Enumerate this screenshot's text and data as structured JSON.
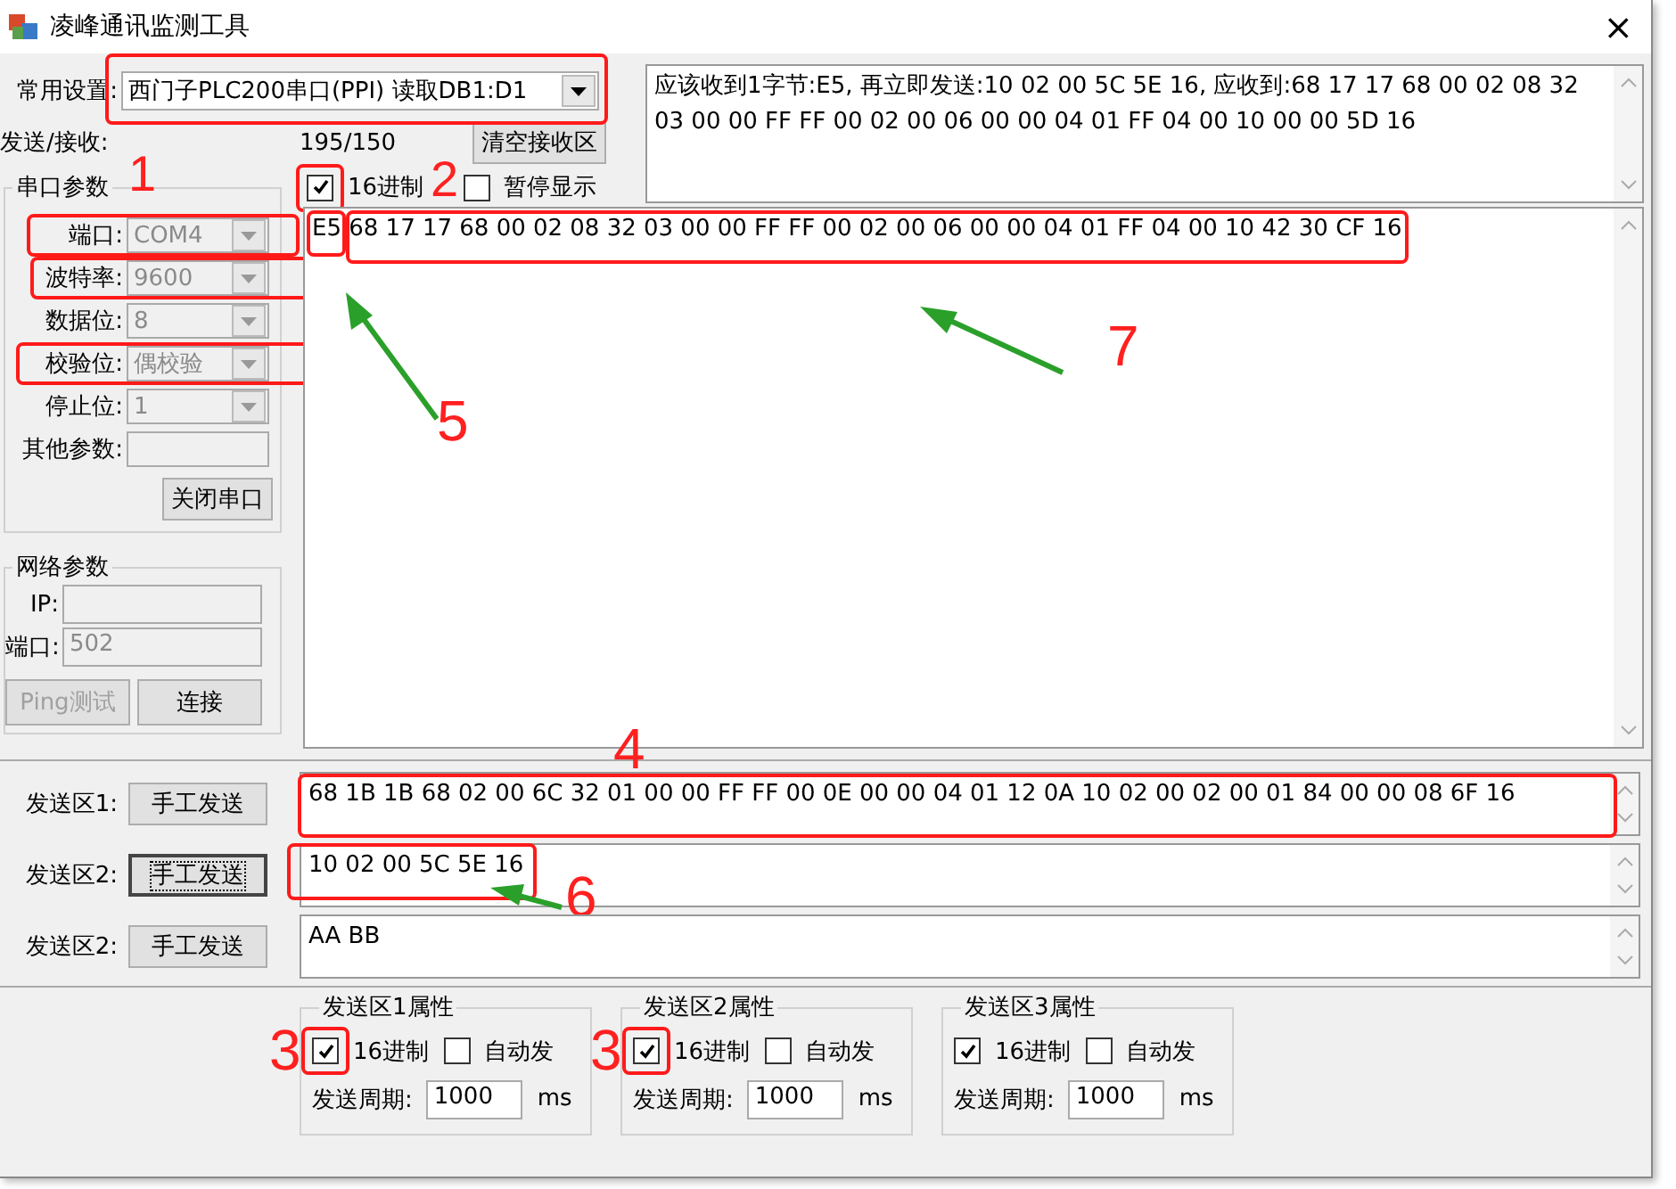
{
  "window": {
    "title": "凌峰通讯监测工具",
    "close": "×"
  },
  "preset": {
    "label": "常用设置:",
    "value": "西门子PLC200串口(PPI) 读取DB1:D1"
  },
  "hint_text": "应该收到1字节:E5, 再立即发送:10 02 00 5C 5E 16, 应收到:68 17 17 68 00 02 08 32 03 00 00 FF FF 00 02 00 06 00 00 04 01 FF 04 00 10 00 00 5D 16",
  "counter": {
    "label": "发送/接收:",
    "value": "195/150"
  },
  "clear_button": "清空接收区",
  "receive_options": [
    {
      "label": "16进制",
      "checked": true
    },
    {
      "label": "暂停显示",
      "checked": false
    }
  ],
  "serial": {
    "title": "串口参数",
    "fields": [
      {
        "label": "端口:",
        "value": "COM4",
        "kind": "combo",
        "disabled": true
      },
      {
        "label": "波特率:",
        "value": "9600",
        "kind": "combo",
        "disabled": true
      },
      {
        "label": "数据位:",
        "value": "8",
        "kind": "combo",
        "disabled": true
      },
      {
        "label": "校验位:",
        "value": "偶校验",
        "kind": "combo",
        "disabled": true
      },
      {
        "label": "停止位:",
        "value": "1",
        "kind": "combo",
        "disabled": true
      },
      {
        "label": "其他参数:",
        "kind": "text",
        "disabled": true
      }
    ],
    "button": "关闭串口"
  },
  "network": {
    "title": "网络参数",
    "fields": [
      {
        "label": "IP:",
        "disabled": true
      },
      {
        "label": "端口:",
        "value": "502",
        "disabled": true
      }
    ],
    "buttons": [
      {
        "label": "Ping测试",
        "disabled": true
      },
      {
        "label": "连接",
        "disabled": false
      }
    ]
  },
  "receive_text": "E5 68 17 17 68 00 02 08 32 03 00 00 FF FF 00 02 00 06 00 00 04 01 FF 04 00 10 42 30 CF 16",
  "send_areas": [
    {
      "label": "发送区1:",
      "button": "手工发送",
      "focused": false,
      "text": "68 1B 1B 68 02 00 6C 32 01 00 00 FF FF 00 0E 00 00 04 01 12 0A 10 02 00 02 00 01 84 00 00 08 6F 16"
    },
    {
      "label": "发送区2:",
      "button": "手工发送",
      "focused": true,
      "text": "10 02 00 5C 5E 16"
    },
    {
      "label": "发送区2:",
      "button": "手工发送",
      "focused": false,
      "text": "AA BB"
    }
  ],
  "send_properties": [
    {
      "title": "发送区1属性",
      "hex": {
        "label": "16进制",
        "checked": true
      },
      "auto": {
        "label": "自动发",
        "checked": false
      },
      "period_label": "发送周期:",
      "period": "1000",
      "unit": "ms"
    },
    {
      "title": "发送区2属性",
      "hex": {
        "label": "16进制",
        "checked": true
      },
      "auto": {
        "label": "自动发",
        "checked": false
      },
      "period_label": "发送周期:",
      "period": "1000",
      "unit": "ms"
    },
    {
      "title": "发送区3属性",
      "hex": {
        "label": "16进制",
        "checked": true
      },
      "auto": {
        "label": "自动发",
        "checked": false
      },
      "period_label": "发送周期:",
      "period": "1000",
      "unit": "ms"
    }
  ],
  "annotations": [
    {
      "label": "1"
    },
    {
      "label": "2"
    },
    {
      "label": "3"
    },
    {
      "label": "3"
    },
    {
      "label": "4"
    },
    {
      "label": "5"
    },
    {
      "label": "6"
    },
    {
      "label": "7"
    }
  ]
}
